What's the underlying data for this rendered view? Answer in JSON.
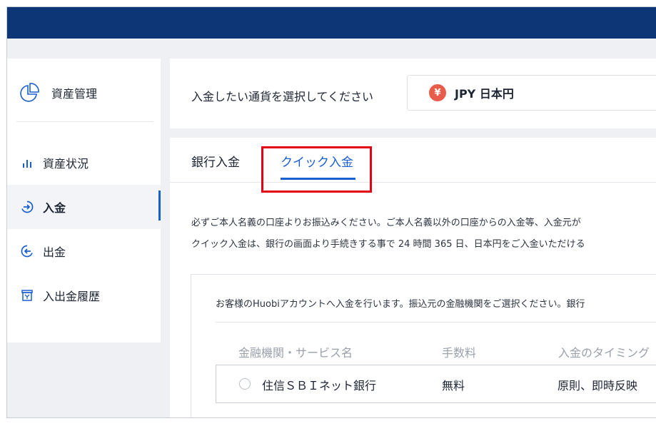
{
  "sidebar": {
    "header_label": "資産管理",
    "items": [
      {
        "label": "資産状況",
        "icon": "bar-chart-icon"
      },
      {
        "label": "入金",
        "icon": "deposit-arrow-icon",
        "active": true
      },
      {
        "label": "出金",
        "icon": "withdraw-arrow-icon"
      },
      {
        "label": "入出金履歴",
        "icon": "history-box-icon"
      }
    ]
  },
  "currency": {
    "prompt": "入金したい通貨を選択してください",
    "symbol": "¥",
    "selected": "JPY 日本円"
  },
  "tabs": {
    "bank": "銀行入金",
    "quick": "クイック入金"
  },
  "notice": {
    "line1": "必ずご本人名義の口座よりお振込みください。ご本人名義以外の口座からの入金等、入金元が",
    "line2": "クイック入金は、銀行の画面より手続きする事で 24 時間 365 日、日本円をご入金いただける"
  },
  "box": {
    "intro": "お客様のHuobiアカウントへ入金を行います。振込元の金融機関をご選択ください。銀行",
    "headers": [
      "金融機関・サービス名",
      "手数料",
      "入金のタイミング"
    ],
    "rows": [
      {
        "name": "住信ＳＢＩネット銀行",
        "fee": "無料",
        "timing": "原則、即時反映"
      }
    ]
  },
  "colors": {
    "topbar": "#0c3675",
    "accent": "#1a5fd0",
    "highlight": "#e30012",
    "yen_badge": "#e85c4a"
  }
}
